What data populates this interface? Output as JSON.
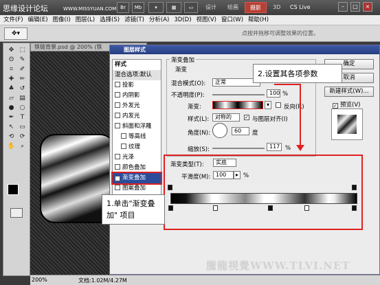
{
  "app": {
    "logo_text": "思缘设计论坛",
    "site_url": "WWW.MISSYUAN.COM",
    "workspaces": [
      "设计",
      "绘画",
      "摄影",
      "3D"
    ],
    "active_workspace": "摄影",
    "cs_live": "CS Live"
  },
  "menu": [
    "文件(F)",
    "编辑(E)",
    "图像(I)",
    "图层(L)",
    "选择(S)",
    "滤镜(T)",
    "分析(A)",
    "3D(D)",
    "视图(V)",
    "窗口(W)",
    "帮助(H)"
  ],
  "options": {
    "hint": "点按并拖移可调整效果的位置。"
  },
  "document": {
    "tab_title": "铁链背景.psd @ 200% (铁",
    "zoom": "200%",
    "doc_size": "文档:1.02M/4.27M"
  },
  "dialog": {
    "title": "图层样式",
    "styles_header": "样式",
    "blend_header": "混合选项:默认",
    "styles": [
      {
        "label": "投影",
        "checked": false
      },
      {
        "label": "内阴影",
        "checked": false
      },
      {
        "label": "外发光",
        "checked": false
      },
      {
        "label": "内发光",
        "checked": false
      },
      {
        "label": "斜面和浮雕",
        "checked": false
      },
      {
        "label": "等高线",
        "checked": false
      },
      {
        "label": "纹理",
        "checked": false
      },
      {
        "label": "光泽",
        "checked": false
      },
      {
        "label": "颜色叠加",
        "checked": false
      },
      {
        "label": "渐变叠加",
        "checked": true
      },
      {
        "label": "图案叠加",
        "checked": false
      }
    ],
    "panel_title": "渐变叠加",
    "group_title": "渐变",
    "blend_mode_label": "混合模式(O):",
    "blend_mode": "正常",
    "opacity_label": "不透明度(P):",
    "opacity": "100",
    "gradient_label": "渐变:",
    "reverse_label": "反向(R)",
    "style_label": "样式(L):",
    "style_value": "对称的",
    "align_label": "与图层对齐(I)",
    "angle_label": "角度(N):",
    "angle": "60",
    "degree_unit": "度",
    "scale_label": "缩放(S):",
    "scale": "117",
    "percent": "%",
    "gradient_type_label": "渐变类型(T):",
    "gradient_type": "实底",
    "smoothness_label": "平滑度(M):",
    "smoothness": "100",
    "buttons": {
      "ok": "确定",
      "cancel": "取消",
      "new_style": "新建样式(W)...",
      "preview": "预览(V)"
    }
  },
  "callouts": {
    "step1": "1.单击\"渐变叠加\" 项目",
    "step2": "2.设置其各项参数"
  },
  "watermark": "騰龍視覺WWW.TLVI.NET",
  "accent_color": "#e02020"
}
